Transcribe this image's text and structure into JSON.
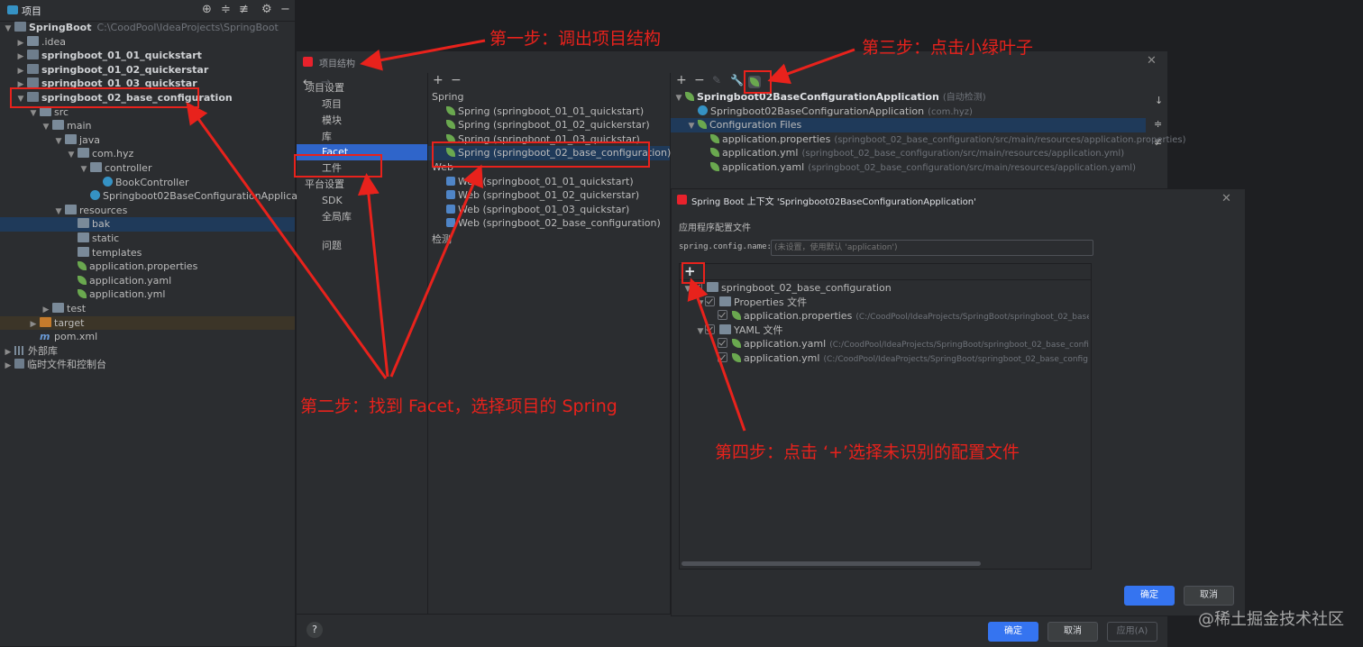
{
  "project_panel": {
    "title": "项目",
    "tree": [
      {
        "depth": 0,
        "arrow": "▼",
        "icon": "module",
        "label": "SpringBoot",
        "path": "C:\\CoodPool\\IdeaProjects\\SpringBoot",
        "bold": true
      },
      {
        "depth": 1,
        "arrow": "▶",
        "icon": "folder",
        "label": ".idea"
      },
      {
        "depth": 1,
        "arrow": "▶",
        "icon": "module",
        "label": "springboot_01_01_quickstart",
        "bold": true
      },
      {
        "depth": 1,
        "arrow": "▶",
        "icon": "module",
        "label": "springboot_01_02_quickerstar",
        "bold": true
      },
      {
        "depth": 1,
        "arrow": "▶",
        "icon": "module",
        "label": "springboot_01_03_quickstar",
        "bold": true
      },
      {
        "depth": 1,
        "arrow": "▼",
        "icon": "module",
        "label": "springboot_02_base_configuration",
        "bold": true
      },
      {
        "depth": 2,
        "arrow": "▼",
        "icon": "folder",
        "label": "src"
      },
      {
        "depth": 3,
        "arrow": "▼",
        "icon": "folder",
        "label": "main"
      },
      {
        "depth": 4,
        "arrow": "▼",
        "icon": "folder",
        "label": "java"
      },
      {
        "depth": 5,
        "arrow": "▼",
        "icon": "folder",
        "label": "com.hyz"
      },
      {
        "depth": 6,
        "arrow": "▼",
        "icon": "folder",
        "label": "controller"
      },
      {
        "depth": 7,
        "arrow": "",
        "icon": "class",
        "label": "BookController"
      },
      {
        "depth": 6,
        "arrow": "",
        "icon": "class",
        "label": "Springboot02BaseConfigurationApplication"
      },
      {
        "depth": 4,
        "arrow": "▼",
        "icon": "folder",
        "label": "resources"
      },
      {
        "depth": 5,
        "arrow": "",
        "icon": "folder",
        "label": "bak",
        "selected": true
      },
      {
        "depth": 5,
        "arrow": "",
        "icon": "folder",
        "label": "static"
      },
      {
        "depth": 5,
        "arrow": "",
        "icon": "folder",
        "label": "templates"
      },
      {
        "depth": 5,
        "arrow": "",
        "icon": "leaf",
        "label": "application.properties"
      },
      {
        "depth": 5,
        "arrow": "",
        "icon": "leaf",
        "label": "application.yaml"
      },
      {
        "depth": 5,
        "arrow": "",
        "icon": "leaf",
        "label": "application.yml"
      },
      {
        "depth": 3,
        "arrow": "▶",
        "icon": "folder",
        "label": "test"
      },
      {
        "depth": 2,
        "arrow": "▶",
        "icon": "orange",
        "label": "target",
        "hl": true
      },
      {
        "depth": 2,
        "arrow": "",
        "icon": "maven",
        "label": "pom.xml"
      },
      {
        "depth": 0,
        "arrow": "▶",
        "icon": "bars",
        "label": "外部库"
      },
      {
        "depth": 0,
        "arrow": "▶",
        "icon": "scratch",
        "label": "临时文件和控制台"
      }
    ]
  },
  "project_structure": {
    "title": "项目结构",
    "nav_back": "←",
    "nav_forward": "→",
    "nav": [
      {
        "label": "项目设置",
        "indent": 0
      },
      {
        "label": "项目",
        "indent": 1
      },
      {
        "label": "模块",
        "indent": 1
      },
      {
        "label": "库",
        "indent": 1
      },
      {
        "label": "Facet",
        "indent": 1,
        "selected": true
      },
      {
        "label": "工件",
        "indent": 1
      },
      {
        "label": "平台设置",
        "indent": 0
      },
      {
        "label": "SDK",
        "indent": 1
      },
      {
        "label": "全局库",
        "indent": 1
      },
      {
        "label": "问题",
        "indent": 1
      }
    ],
    "facet_toolbar": [
      "+",
      "−"
    ],
    "facets": [
      {
        "label": "Spring",
        "group": true
      },
      {
        "label": "Spring (springboot_01_01_quickstart)",
        "icon": "leaf"
      },
      {
        "label": "Spring (springboot_01_02_quickerstar)",
        "icon": "leaf"
      },
      {
        "label": "Spring (springboot_01_03_quickstar)",
        "icon": "leaf"
      },
      {
        "label": "Spring (springboot_02_base_configuration)",
        "icon": "leaf",
        "selected": true
      },
      {
        "label": "Web",
        "group": true
      },
      {
        "label": "Web (springboot_01_01_quickstart)",
        "icon": "web"
      },
      {
        "label": "Web (springboot_01_02_quickerstar)",
        "icon": "web"
      },
      {
        "label": "Web (springboot_01_03_quickstar)",
        "icon": "web"
      },
      {
        "label": "Web (springboot_02_base_configuration)",
        "icon": "web"
      },
      {
        "label": "检测",
        "group": true
      }
    ],
    "context_tree": [
      {
        "depth": 0,
        "arrow": "▼",
        "label": "Springboot02BaseConfigurationApplication",
        "extra": "(自动检测)",
        "bold": true
      },
      {
        "depth": 1,
        "arrow": "",
        "label": "Springboot02BaseConfigurationApplication",
        "extra": "(com.hyz)"
      },
      {
        "depth": 1,
        "arrow": "▼",
        "label": "Configuration Files",
        "extra": "",
        "selected": true
      },
      {
        "depth": 2,
        "arrow": "",
        "label": "application.properties",
        "extra": "(springboot_02_base_configuration/src/main/resources/application.properties)"
      },
      {
        "depth": 2,
        "arrow": "",
        "label": "application.yml",
        "extra": "(springboot_02_base_configuration/src/main/resources/application.yml)"
      },
      {
        "depth": 2,
        "arrow": "",
        "label": "application.yaml",
        "extra": "(springboot_02_base_configuration/src/main/resources/application.yaml)"
      }
    ],
    "help": "?",
    "ok": "确定",
    "cancel": "取消",
    "apply": "应用(A)"
  },
  "spring_context": {
    "title": "Spring Boot 上下文 'Springboot02BaseConfigurationApplication'",
    "section": "应用程序配置文件",
    "config_name_label": "spring.config.name:",
    "config_name_placeholder": "(未设置，使用默认 'application')",
    "add": "+",
    "tree": [
      {
        "depth": 0,
        "arrow": "▼",
        "label": "springboot_02_base_configuration",
        "extra": ""
      },
      {
        "depth": 1,
        "arrow": "▼",
        "label": "Properties 文件",
        "extra": ""
      },
      {
        "depth": 2,
        "arrow": "",
        "label": "application.properties",
        "extra": "(C:/CoodPool/IdeaProjects/SpringBoot/springboot_02_base_"
      },
      {
        "depth": 1,
        "arrow": "▼",
        "label": "YAML 文件",
        "extra": ""
      },
      {
        "depth": 2,
        "arrow": "",
        "label": "application.yaml",
        "extra": "(C:/CoodPool/IdeaProjects/SpringBoot/springboot_02_base_confi"
      },
      {
        "depth": 2,
        "arrow": "",
        "label": "application.yml",
        "extra": "(C:/CoodPool/IdeaProjects/SpringBoot/springboot_02_base_config"
      }
    ],
    "ok": "确定",
    "cancel": "取消"
  },
  "annotations": {
    "step1": "第一步：调出项目结构",
    "step2": "第二步：找到 Facet，选择项目的 Spring",
    "step3": "第三步：点击小绿叶子",
    "step4": "第四步：点击 ‘+’选择未识别的配置文件"
  },
  "watermark": "@稀土掘金技术社区",
  "colors": {
    "accent": "#3574f0",
    "annotation": "#e8221c",
    "selection": "#1f3a5a",
    "spring": "#6aa84f"
  }
}
